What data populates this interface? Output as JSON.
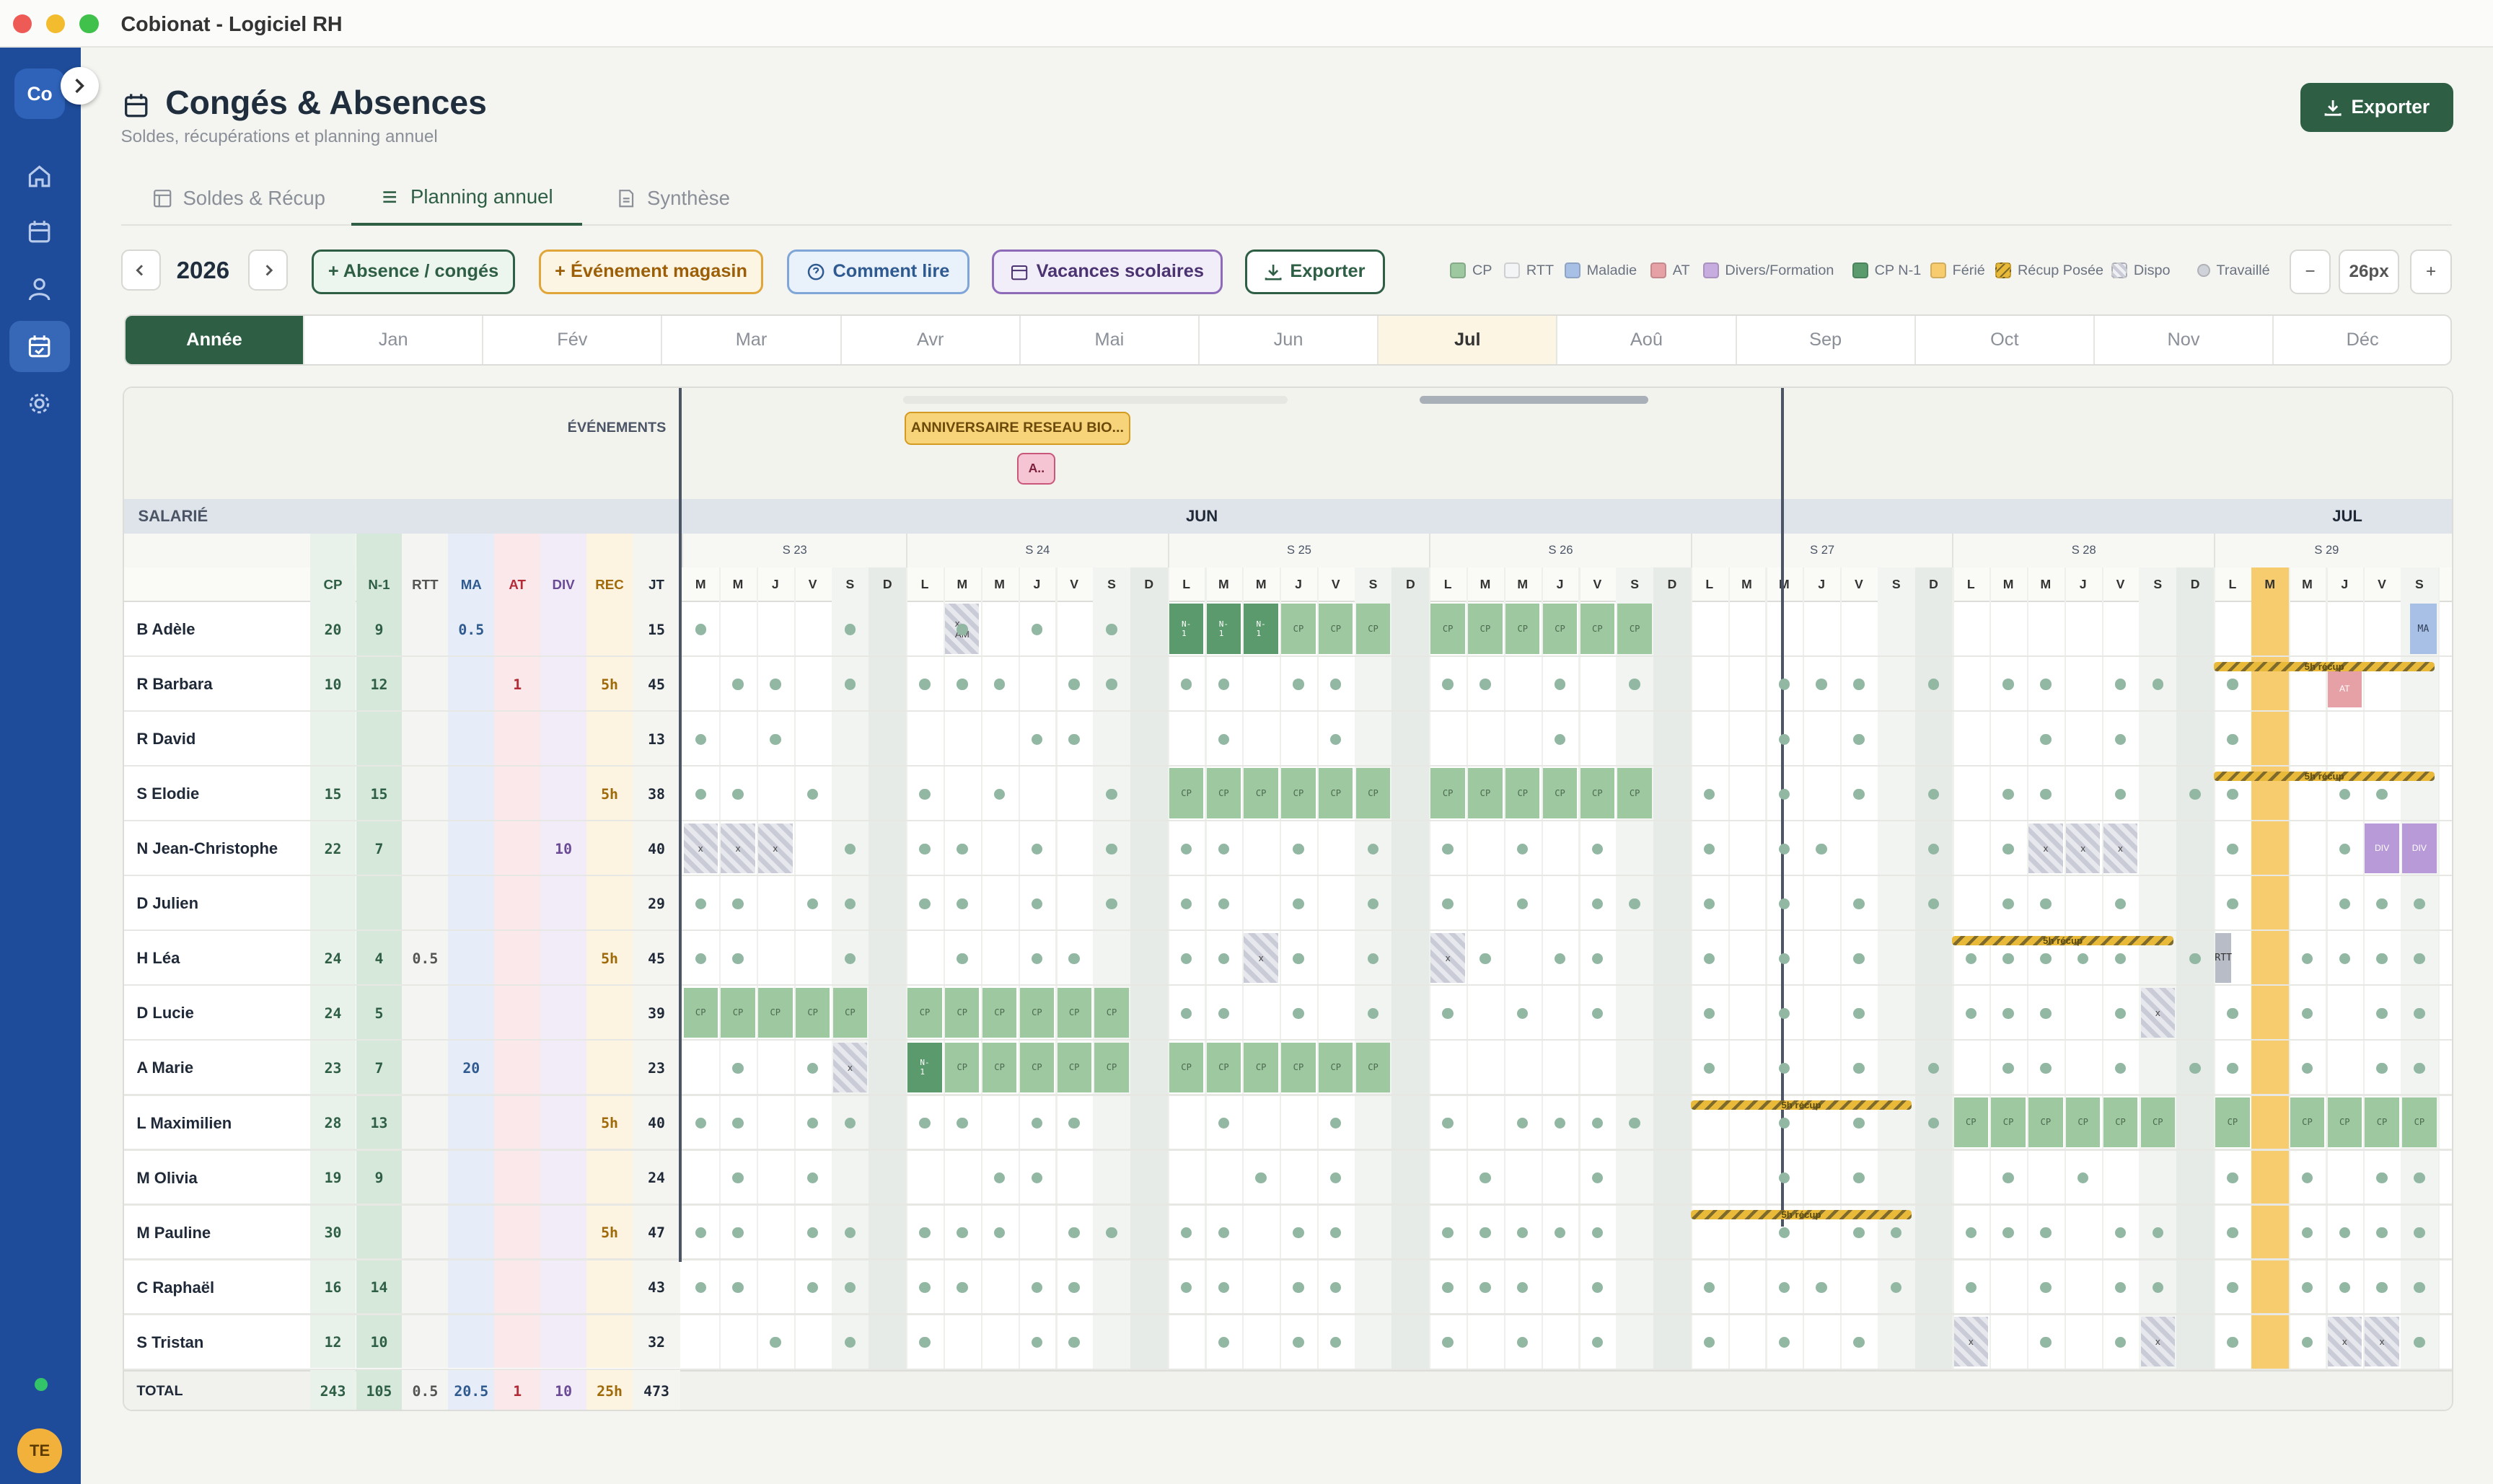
{
  "window": {
    "title": "Cobionat - Logiciel RH"
  },
  "sidebar": {
    "logo": "Co",
    "avatar": "TE",
    "items": [
      "home-icon",
      "calendar-icon",
      "user-icon",
      "calendar-check-icon",
      "gear-icon"
    ],
    "active_index": 3
  },
  "page": {
    "title": "Congés & Absences",
    "subtitle": "Soldes, récupérations et planning annuel",
    "export": "Exporter"
  },
  "tabs": [
    {
      "label": "Soldes & Récup",
      "active": false
    },
    {
      "label": "Planning annuel",
      "active": true
    },
    {
      "label": "Synthèse",
      "active": false
    }
  ],
  "toolbar": {
    "year": "2026",
    "add_absence": "+ Absence / congés",
    "add_event": "+ Événement magasin",
    "help": "Comment lire",
    "holidays": "Vacances scolaires",
    "export": "Exporter",
    "zoom_value": "26px",
    "minus": "−",
    "plus": "+"
  },
  "legend": [
    {
      "label": "CP",
      "color": "#9ec89f"
    },
    {
      "label": "RTT",
      "color": "#f3f4f6"
    },
    {
      "label": "Maladie",
      "color": "#a9c0e6"
    },
    {
      "label": "AT",
      "color": "#e6a1a6"
    },
    {
      "label": "Divers/Formation",
      "color": "#c7acdf"
    },
    {
      "label": "CP N-1",
      "color": "#5b9a6d"
    },
    {
      "label": "Férié",
      "color": "#f6cc6f"
    },
    {
      "label": "Récup Posée",
      "color": "#e9b93a"
    },
    {
      "label": "Dispo",
      "color": "#c9ccd6"
    },
    {
      "label": "Travaillé",
      "color": "#cfd2d8"
    }
  ],
  "months": [
    "Année",
    "Jan",
    "Fév",
    "Mar",
    "Avr",
    "Mai",
    "Jun",
    "Jul",
    "Aoû",
    "Sep",
    "Oct",
    "Nov",
    "Déc"
  ],
  "grid": {
    "events_label": "ÉVÉNEMENTS",
    "event_main": "ANNIVERSAIRE RESEAU BIO...",
    "event_small": "A..",
    "salarie_label": "SALARIÉ",
    "month_jun": "JUN",
    "month_jul": "JUL",
    "weeks": [
      "S 23",
      "S 24",
      "S 25",
      "S 26",
      "S 27",
      "S 28",
      "S 29"
    ],
    "day_letters": [
      "M",
      "M",
      "J",
      "V",
      "S",
      "D",
      "L",
      "M",
      "M",
      "J",
      "V",
      "S",
      "D",
      "L",
      "M",
      "M",
      "J",
      "V",
      "S",
      "D",
      "L",
      "M",
      "M",
      "J",
      "V",
      "S",
      "D",
      "L",
      "M",
      "M",
      "J",
      "V",
      "S",
      "D",
      "L",
      "M",
      "M",
      "J",
      "V",
      "S",
      "D",
      "L",
      "M",
      "M",
      "J",
      "V",
      "S"
    ],
    "columns": [
      "CP",
      "N-1",
      "RTT",
      "MA",
      "AT",
      "DIV",
      "REC",
      "JT"
    ],
    "employees": [
      {
        "name": "B Adèle",
        "cp": "20",
        "n1": "9",
        "rtt": "",
        "ma": "0.5",
        "at": "",
        "div": "",
        "rec": "",
        "jt": "15"
      },
      {
        "name": "R Barbara",
        "cp": "10",
        "n1": "12",
        "rtt": "",
        "ma": "",
        "at": "1",
        "div": "",
        "rec": "5h",
        "jt": "45"
      },
      {
        "name": "R David",
        "cp": "",
        "n1": "",
        "rtt": "",
        "ma": "",
        "at": "",
        "div": "",
        "rec": "",
        "jt": "13"
      },
      {
        "name": "S Elodie",
        "cp": "15",
        "n1": "15",
        "rtt": "",
        "ma": "",
        "at": "",
        "div": "",
        "rec": "5h",
        "jt": "38"
      },
      {
        "name": "N Jean-Christophe",
        "cp": "22",
        "n1": "7",
        "rtt": "",
        "ma": "",
        "at": "",
        "div": "10",
        "rec": "",
        "jt": "40"
      },
      {
        "name": "D Julien",
        "cp": "",
        "n1": "",
        "rtt": "",
        "ma": "",
        "at": "",
        "div": "",
        "rec": "",
        "jt": "29"
      },
      {
        "name": "H Léa",
        "cp": "24",
        "n1": "4",
        "rtt": "0.5",
        "ma": "",
        "at": "",
        "div": "",
        "rec": "5h",
        "jt": "45"
      },
      {
        "name": "D Lucie",
        "cp": "24",
        "n1": "5",
        "rtt": "",
        "ma": "",
        "at": "",
        "div": "",
        "rec": "",
        "jt": "39"
      },
      {
        "name": "A Marie",
        "cp": "23",
        "n1": "7",
        "rtt": "",
        "ma": "20",
        "at": "",
        "div": "",
        "rec": "",
        "jt": "23"
      },
      {
        "name": "L Maximilien",
        "cp": "28",
        "n1": "13",
        "rtt": "",
        "ma": "",
        "at": "",
        "div": "",
        "rec": "5h",
        "jt": "40"
      },
      {
        "name": "M Olivia",
        "cp": "19",
        "n1": "9",
        "rtt": "",
        "ma": "",
        "at": "",
        "div": "",
        "rec": "",
        "jt": "24"
      },
      {
        "name": "M Pauline",
        "cp": "30",
        "n1": "",
        "rtt": "",
        "ma": "",
        "at": "",
        "div": "",
        "rec": "5h",
        "jt": "47"
      },
      {
        "name": "C Raphaël",
        "cp": "16",
        "n1": "14",
        "rtt": "",
        "ma": "",
        "at": "",
        "div": "",
        "rec": "",
        "jt": "43"
      },
      {
        "name": "S Tristan",
        "cp": "12",
        "n1": "10",
        "rtt": "",
        "ma": "",
        "at": "",
        "div": "",
        "rec": "",
        "jt": "32"
      }
    ],
    "totals": {
      "label": "TOTAL",
      "cp": "243",
      "n1": "105",
      "rtt": "0.5",
      "ma": "20.5",
      "at": "1",
      "div": "10",
      "rec": "25h",
      "jt": "473"
    },
    "cell_text": {
      "cp": "CP",
      "n1": "N-\n1",
      "x": "x",
      "xam": "x\nAM",
      "ma": "MA",
      "at": "AT",
      "div": "DIV",
      "recup": "5h récup",
      "rtt": "RTT"
    }
  }
}
